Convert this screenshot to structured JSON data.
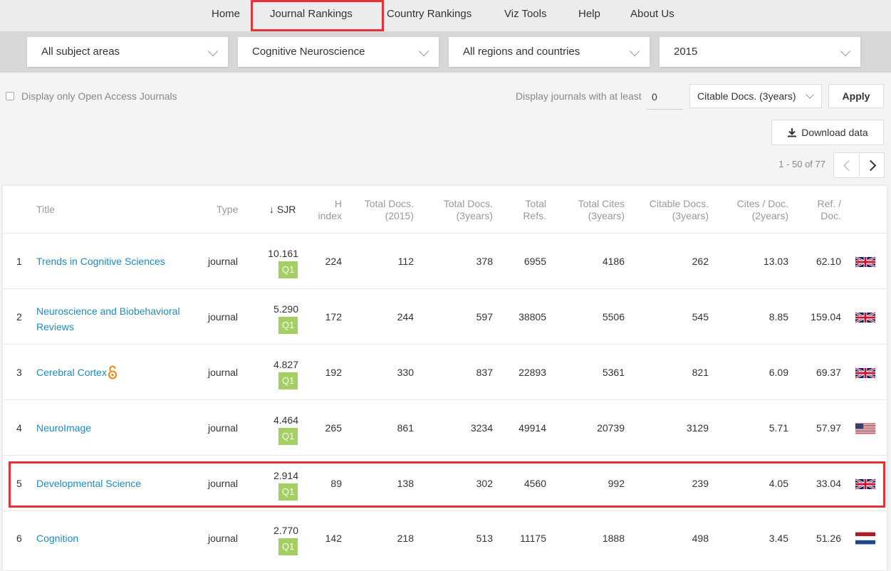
{
  "nav": {
    "items": [
      "Home",
      "Journal Rankings",
      "Country Rankings",
      "Viz Tools",
      "Help",
      "About Us"
    ]
  },
  "filters": {
    "subject_area": "All subject areas",
    "subject_category": "Cognitive Neuroscience",
    "region": "All regions and countries",
    "year": "2015"
  },
  "options": {
    "open_access_label": "Display only Open Access Journals",
    "min_label": "Display journals with at least",
    "min_value": "0",
    "min_type": "Citable Docs. (3years)",
    "apply": "Apply",
    "download": "Download data",
    "pagination": "1 - 50 of 77"
  },
  "table": {
    "headers": {
      "title": "Title",
      "type": "Type",
      "sjr": "SJR",
      "h1": "H",
      "h2": "index",
      "td2015_1": "Total Docs.",
      "td2015_2": "(2015)",
      "td3_1": "Total Docs.",
      "td3_2": "(3years)",
      "refs_1": "Total",
      "refs_2": "Refs.",
      "cites_1": "Total Cites",
      "cites_2": "(3years)",
      "citable_1": "Citable Docs.",
      "citable_2": "(3years)",
      "cpd_1": "Cites / Doc.",
      "cpd_2": "(2years)",
      "rpd_1": "Ref. /",
      "rpd_2": "Doc."
    },
    "rows": [
      {
        "rank": "1",
        "title": "Trends in Cognitive Sciences",
        "type": "journal",
        "sjr": "10.161",
        "quartile": "Q1",
        "h": "224",
        "docs2015": "112",
        "docs3": "378",
        "refs": "6955",
        "cites3": "4186",
        "citable3": "262",
        "cpd": "13.03",
        "rpd": "62.10",
        "flag": "uk"
      },
      {
        "rank": "2",
        "title": "Neuroscience and Biobehavioral Reviews",
        "title_l1": "Neuroscience and Biobehavioral",
        "title_l2": "Reviews",
        "type": "journal",
        "sjr": "5.290",
        "quartile": "Q1",
        "h": "172",
        "docs2015": "244",
        "docs3": "597",
        "refs": "38805",
        "cites3": "5506",
        "citable3": "545",
        "cpd": "8.85",
        "rpd": "159.04",
        "flag": "uk"
      },
      {
        "rank": "3",
        "title": "Cerebral Cortex",
        "type": "journal",
        "sjr": "4.827",
        "quartile": "Q1",
        "h": "192",
        "docs2015": "330",
        "docs3": "837",
        "refs": "22893",
        "cites3": "5361",
        "citable3": "821",
        "cpd": "6.09",
        "rpd": "69.37",
        "flag": "uk",
        "open_access": true
      },
      {
        "rank": "4",
        "title": "NeuroImage",
        "type": "journal",
        "sjr": "4.464",
        "quartile": "Q1",
        "h": "265",
        "docs2015": "861",
        "docs3": "3234",
        "refs": "49914",
        "cites3": "20739",
        "citable3": "3129",
        "cpd": "5.71",
        "rpd": "57.97",
        "flag": "us"
      },
      {
        "rank": "5",
        "title": "Developmental Science",
        "type": "journal",
        "sjr": "2.914",
        "quartile": "Q1",
        "h": "89",
        "docs2015": "138",
        "docs3": "302",
        "refs": "4560",
        "cites3": "992",
        "citable3": "239",
        "cpd": "4.05",
        "rpd": "33.04",
        "flag": "uk",
        "highlighted": true
      },
      {
        "rank": "6",
        "title": "Cognition",
        "type": "journal",
        "sjr": "2.770",
        "quartile": "Q1",
        "h": "142",
        "docs2015": "218",
        "docs3": "513",
        "refs": "11175",
        "cites3": "1888",
        "citable3": "498",
        "cpd": "3.45",
        "rpd": "51.26",
        "flag": "nl"
      }
    ]
  },
  "colors": {
    "link": "#1e8bc3",
    "quartile_q1": "#a4cf63",
    "highlight": "#e53238"
  }
}
